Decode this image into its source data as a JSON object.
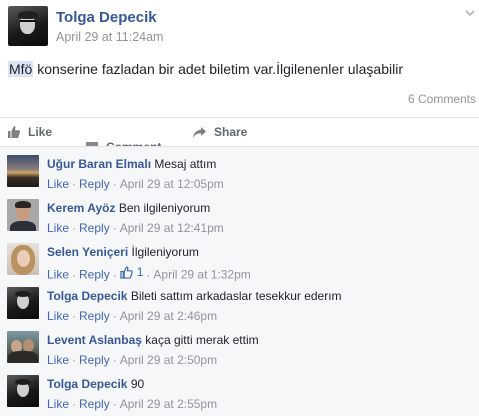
{
  "post": {
    "author": "Tolga Depecik",
    "time": "April 29 at 11:24am",
    "text_highlight": "Mfö",
    "text_rest": " konserine fazladan bir adet biletim var.İlgilenenler ulaşabilir",
    "comment_count": "6 Comments"
  },
  "actions": {
    "like": "Like",
    "comment": "Comment",
    "share": "Share"
  },
  "comments": [
    {
      "name": "Uğur Baran Elmalı",
      "text": "Mesaj attım",
      "like": "Like",
      "reply": "Reply",
      "time": "April 29 at 12:05pm",
      "likes": ""
    },
    {
      "name": "Kerem Ayöz",
      "text": "Ben ilgileniyorum",
      "like": "Like",
      "reply": "Reply",
      "time": "April 29 at 12:41pm",
      "likes": ""
    },
    {
      "name": "Selen Yeniçeri",
      "text": "İlgileniyorum",
      "like": "Like",
      "reply": "Reply",
      "time": "April 29 at 1:32pm",
      "likes": "1"
    },
    {
      "name": "Tolga Depecik",
      "text": "Bileti sattım arkadaslar tesekkur ederım",
      "like": "Like",
      "reply": "Reply",
      "time": "April 29 at 2:46pm",
      "likes": ""
    },
    {
      "name": "Levent Aslanbaş",
      "text": "kaça gitti merak ettim",
      "like": "Like",
      "reply": "Reply",
      "time": "April 29 at 2:50pm",
      "likes": ""
    },
    {
      "name": "Tolga Depecik",
      "text": "90",
      "like": "Like",
      "reply": "Reply",
      "time": "April 29 at 2:55pm",
      "likes": ""
    }
  ],
  "colors": {
    "link": "#365899",
    "meta": "#90949c",
    "action": "#616770",
    "comments_bg": "#f6f7f9"
  },
  "icons": {
    "post_menu": "chevron-down-icon",
    "like_action": "thumbs-up-icon",
    "comment_action": "speech-bubble-icon",
    "share_action": "share-arrow-icon",
    "comment_likes": "thumbs-up-icon"
  }
}
